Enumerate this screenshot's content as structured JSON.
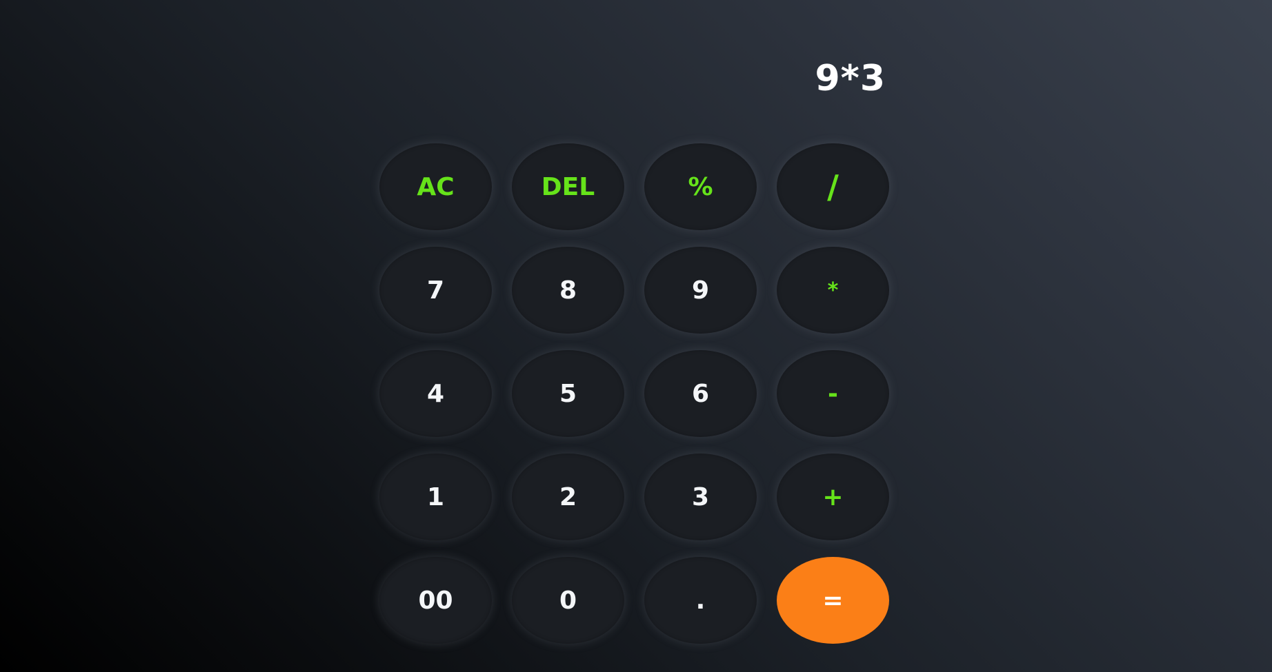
{
  "display": {
    "expression": "9*3"
  },
  "keypad": {
    "rows": [
      [
        {
          "label": "AC",
          "kind": "fn"
        },
        {
          "label": "DEL",
          "kind": "fn"
        },
        {
          "label": "%",
          "kind": "fn"
        },
        {
          "label": "/",
          "kind": "op"
        }
      ],
      [
        {
          "label": "7",
          "kind": "digit"
        },
        {
          "label": "8",
          "kind": "digit"
        },
        {
          "label": "9",
          "kind": "digit"
        },
        {
          "label": "*",
          "kind": "op"
        }
      ],
      [
        {
          "label": "4",
          "kind": "digit"
        },
        {
          "label": "5",
          "kind": "digit"
        },
        {
          "label": "6",
          "kind": "digit"
        },
        {
          "label": "-",
          "kind": "op"
        }
      ],
      [
        {
          "label": "1",
          "kind": "digit"
        },
        {
          "label": "2",
          "kind": "digit"
        },
        {
          "label": "3",
          "kind": "digit"
        },
        {
          "label": "+",
          "kind": "op"
        }
      ],
      [
        {
          "label": "00",
          "kind": "digit"
        },
        {
          "label": "0",
          "kind": "digit"
        },
        {
          "label": ".",
          "kind": "digit"
        },
        {
          "label": "=",
          "kind": "equals"
        }
      ]
    ]
  },
  "colors": {
    "accent_green": "#66e31a",
    "equals_orange": "#fb7f17",
    "key_background": "#1b1e23",
    "text_white": "#ffffff"
  }
}
